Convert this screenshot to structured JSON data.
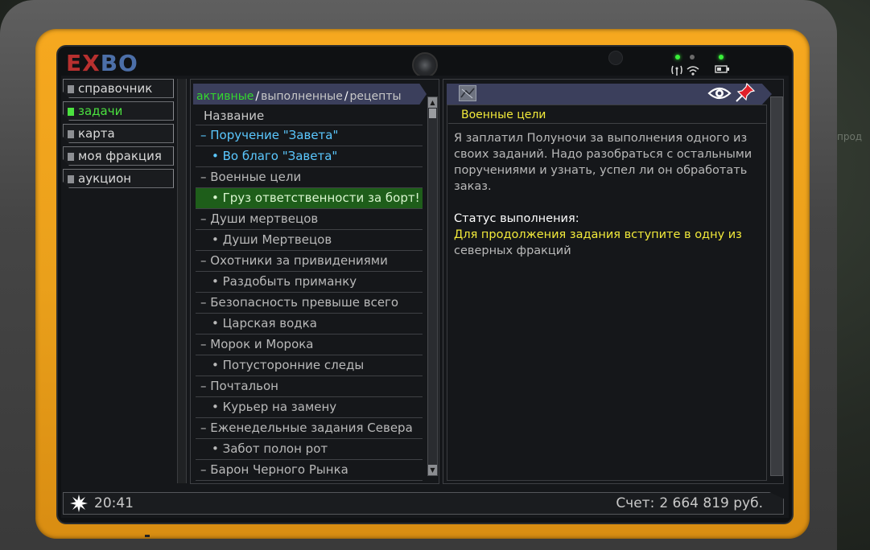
{
  "logo": {
    "part1": "EX",
    "part2": "BO"
  },
  "background_text": "прод",
  "nav": {
    "items": [
      {
        "label": "справочник",
        "active": false
      },
      {
        "label": "задачи",
        "active": true
      },
      {
        "label": "карта",
        "active": false
      },
      {
        "label": "моя фракция",
        "active": false
      },
      {
        "label": "аукцион",
        "active": false
      }
    ]
  },
  "tabs": {
    "active": "активные",
    "completed": "выполненные",
    "recipes": "рецепты",
    "separator": "/"
  },
  "task_list": {
    "header": "Название",
    "rows": [
      {
        "text": "– Поручение \"Завета\"",
        "level": 0,
        "state": "highlight"
      },
      {
        "text": "• Во благо \"Завета\"",
        "level": 1,
        "state": "highlight"
      },
      {
        "text": "– Военные цели",
        "level": 0,
        "state": "normal"
      },
      {
        "text": "• Груз ответственности за борт!",
        "level": 1,
        "state": "selected"
      },
      {
        "text": "– Души мертвецов",
        "level": 0,
        "state": "normal"
      },
      {
        "text": "• Души Мертвецов",
        "level": 1,
        "state": "normal"
      },
      {
        "text": "– Охотники за привидениями",
        "level": 0,
        "state": "normal"
      },
      {
        "text": "• Раздобыть приманку",
        "level": 1,
        "state": "normal"
      },
      {
        "text": "– Безопасность превыше всего",
        "level": 0,
        "state": "normal"
      },
      {
        "text": "• Царская водка",
        "level": 1,
        "state": "normal"
      },
      {
        "text": "– Морок и Морока",
        "level": 0,
        "state": "normal"
      },
      {
        "text": "• Потусторонние следы",
        "level": 1,
        "state": "normal"
      },
      {
        "text": "– Почтальон",
        "level": 0,
        "state": "normal"
      },
      {
        "text": "• Курьер на замену",
        "level": 1,
        "state": "normal"
      },
      {
        "text": "– Еженедельные задания Севера",
        "level": 0,
        "state": "normal"
      },
      {
        "text": "• Забот полон рот",
        "level": 1,
        "state": "normal"
      },
      {
        "text": "– Барон Черного Рынка",
        "level": 0,
        "state": "normal"
      }
    ]
  },
  "detail": {
    "title": "Военные цели",
    "description": "Я заплатил Полуночи за выполнения одного из своих заданий. Надо разобраться с остальными поручениями и узнать, успел ли он обработать заказ.",
    "status_label": "Статус выполнения:",
    "status_highlight": "Для продолжения задания вступите в одну из",
    "status_rest": "северных фракций"
  },
  "status_bar": {
    "time": "20:41",
    "score_label": "Счет:",
    "score_value": "2 664 819 руб."
  },
  "colors": {
    "accent_green": "#4be13f",
    "highlight_blue": "#5bc8ff",
    "title_yellow": "#f2ea3a",
    "selected_row": "#1e5e1a",
    "header_bar": "#3b3f5c",
    "frame_orange": "#f6a81f"
  },
  "icons": {
    "eye": "eye-icon",
    "pin": "pin-icon",
    "sun": "sun-icon",
    "signal": "signal-icon",
    "battery": "battery-icon"
  }
}
